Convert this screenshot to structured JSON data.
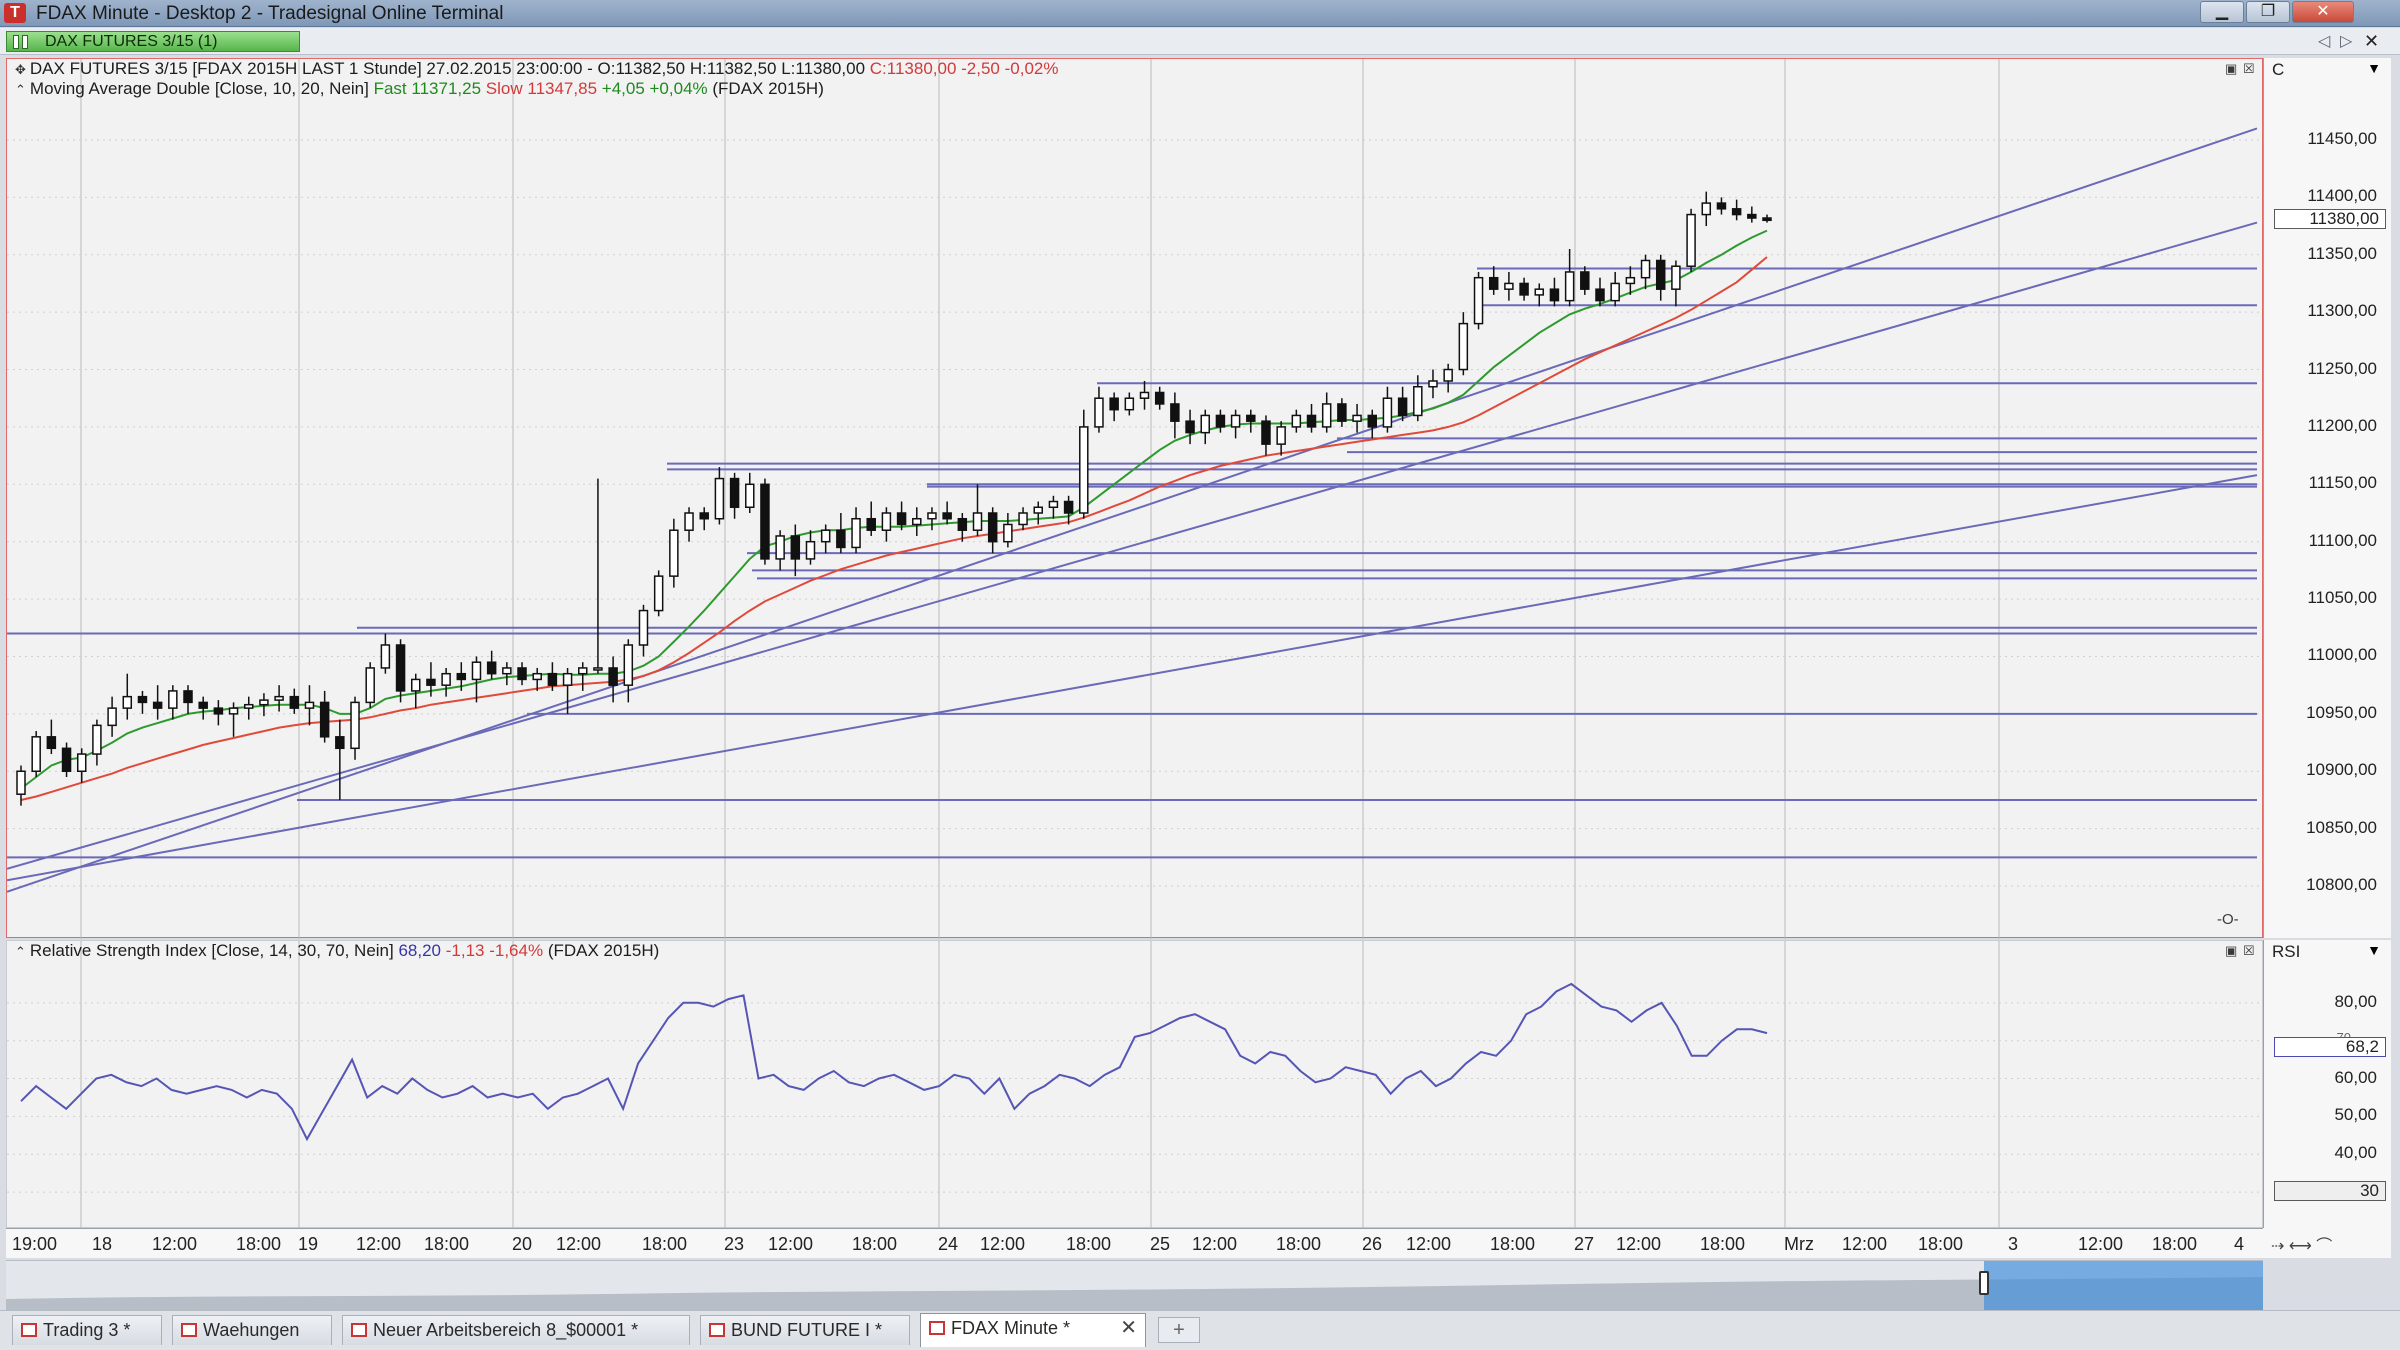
{
  "window": {
    "title": "FDAX Minute - Desktop 2 - Tradesignal Online Terminal",
    "app_icon": "tradesignal-icon",
    "controls": [
      "minimize-icon",
      "maximize-icon",
      "close-icon"
    ]
  },
  "chart_tab": {
    "label": "DAX FUTURES 3/15 (1)",
    "color": "#57b54b"
  },
  "price_pane": {
    "legend_line1": {
      "prefix": "DAX FUTURES 3/15 [FDAX 2015H LAST 1 Stunde] 27.02.2015 23:00:00 - O:11382,50 H:11382,50 L:11380,00",
      "close_change": "C:11380,00 -2,50 -0,02%"
    },
    "legend_line2": {
      "prefix": "Moving Average Double [Close, 10, 20, Nein]",
      "fast_label": "Fast",
      "fast_value": "11371,25",
      "slow_label": "Slow",
      "slow_value": "11347,85",
      "change": "+4,05 +0,04%",
      "symbol": "(FDAX 2015H)"
    },
    "axis_header": "C",
    "current_price_label": "11380,00",
    "axis_ticks": [
      "11450,00",
      "11400,00",
      "11350,00",
      "11300,00",
      "11250,00",
      "11200,00",
      "11150,00",
      "11100,00",
      "11050,00",
      "11000,00",
      "10950,00",
      "10900,00",
      "10850,00",
      "10800,00"
    ],
    "corner_icon": "-O-"
  },
  "rsi_pane": {
    "legend": {
      "prefix": "Relative Strength Index [Close, 14, 30, 70, Nein]",
      "value": "68,20",
      "change": "-1,13 -1,64%",
      "symbol": "(FDAX 2015H)"
    },
    "axis_header": "RSI",
    "axis_ticks": [
      "80,00",
      "70",
      "60,00",
      "50,00",
      "40,00"
    ],
    "current_value_label": "68,2",
    "lower_band_label": "30"
  },
  "time_axis": {
    "labels": [
      "19:00",
      "18",
      "12:00",
      "18:00",
      "19",
      "12:00",
      "18:00",
      "20",
      "12:00",
      "18:00",
      "23",
      "12:00",
      "18:00",
      "24",
      "12:00",
      "18:00",
      "25",
      "12:00",
      "18:00",
      "26",
      "12:00",
      "18:00",
      "27",
      "12:00",
      "18:00",
      "Mrz",
      "12:00",
      "18:00",
      "3",
      "12:00",
      "18:00",
      "4"
    ]
  },
  "bottom_tabs": [
    {
      "label": "Trading 3 *",
      "active": false
    },
    {
      "label": "Waehungen",
      "active": false
    },
    {
      "label": "Neuer Arbeitsbereich 8_$00001 *",
      "active": false
    },
    {
      "label": "BUND FUTURE I *",
      "active": false
    },
    {
      "label": "FDAX Minute *",
      "active": true
    }
  ],
  "colors": {
    "candle": "#111111",
    "fast_ma": "#2e9a2e",
    "slow_ma": "#e04a3a",
    "trendline": "#6a6ab8",
    "rsi_line": "#5555b5",
    "pane_border": "#e06a6a"
  },
  "chart_data": [
    {
      "type": "candlestick",
      "title": "DAX FUTURES 3/15",
      "ylim": [
        10780,
        11470
      ],
      "x_labels": [
        "18",
        "19",
        "20",
        "23",
        "24",
        "25",
        "26",
        "27"
      ],
      "candles": [
        [
          10880,
          10905,
          10870,
          10900
        ],
        [
          10900,
          10935,
          10895,
          10930
        ],
        [
          10930,
          10945,
          10915,
          10920
        ],
        [
          10920,
          10925,
          10895,
          10900
        ],
        [
          10900,
          10920,
          10890,
          10915
        ],
        [
          10915,
          10945,
          10905,
          10940
        ],
        [
          10940,
          10965,
          10930,
          10955
        ],
        [
          10955,
          10985,
          10945,
          10965
        ],
        [
          10965,
          10970,
          10950,
          10960
        ],
        [
          10960,
          10975,
          10945,
          10955
        ],
        [
          10955,
          10975,
          10945,
          10970
        ],
        [
          10970,
          10975,
          10950,
          10960
        ],
        [
          10960,
          10965,
          10945,
          10955
        ],
        [
          10955,
          10962,
          10940,
          10950
        ],
        [
          10950,
          10960,
          10930,
          10955
        ],
        [
          10955,
          10965,
          10945,
          10958
        ],
        [
          10958,
          10968,
          10948,
          10962
        ],
        [
          10962,
          10975,
          10952,
          10965
        ],
        [
          10965,
          10972,
          10950,
          10955
        ],
        [
          10955,
          10975,
          10940,
          10960
        ],
        [
          10960,
          10970,
          10925,
          10930
        ],
        [
          10930,
          10945,
          10875,
          10920
        ],
        [
          10920,
          10965,
          10910,
          10960
        ],
        [
          10960,
          10995,
          10955,
          10990
        ],
        [
          10990,
          11020,
          10985,
          11010
        ],
        [
          11010,
          11015,
          10960,
          10970
        ],
        [
          10970,
          10985,
          10955,
          10980
        ],
        [
          10980,
          10995,
          10965,
          10975
        ],
        [
          10975,
          10990,
          10965,
          10985
        ],
        [
          10985,
          10995,
          10970,
          10980
        ],
        [
          10980,
          11000,
          10960,
          10995
        ],
        [
          10995,
          11005,
          10980,
          10985
        ],
        [
          10985,
          10995,
          10975,
          10990
        ],
        [
          10990,
          10995,
          10975,
          10980
        ],
        [
          10980,
          10990,
          10970,
          10985
        ],
        [
          10985,
          10995,
          10970,
          10975
        ],
        [
          10975,
          10990,
          10950,
          10985
        ],
        [
          10985,
          10995,
          10970,
          10990
        ],
        [
          10990,
          11155,
          10985,
          10990
        ],
        [
          10990,
          11000,
          10960,
          10975
        ],
        [
          10975,
          11015,
          10960,
          11010
        ],
        [
          11010,
          11045,
          11000,
          11040
        ],
        [
          11040,
          11075,
          11035,
          11070
        ],
        [
          11070,
          11120,
          11060,
          11110
        ],
        [
          11110,
          11130,
          11100,
          11125
        ],
        [
          11125,
          11130,
          11110,
          11120
        ],
        [
          11120,
          11165,
          11115,
          11155
        ],
        [
          11155,
          11160,
          11120,
          11130
        ],
        [
          11130,
          11160,
          11125,
          11150
        ],
        [
          11150,
          11155,
          11080,
          11085
        ],
        [
          11085,
          11110,
          11075,
          11105
        ],
        [
          11105,
          11115,
          11070,
          11085
        ],
        [
          11085,
          11110,
          11080,
          11100
        ],
        [
          11100,
          11115,
          11090,
          11110
        ],
        [
          11110,
          11125,
          11090,
          11095
        ],
        [
          11095,
          11130,
          11090,
          11120
        ],
        [
          11120,
          11135,
          11105,
          11110
        ],
        [
          11110,
          11130,
          11100,
          11125
        ],
        [
          11125,
          11135,
          11110,
          11115
        ],
        [
          11115,
          11130,
          11105,
          11120
        ],
        [
          11120,
          11130,
          11110,
          11125
        ],
        [
          11125,
          11135,
          11115,
          11120
        ],
        [
          11120,
          11125,
          11100,
          11110
        ],
        [
          11110,
          11150,
          11105,
          11125
        ],
        [
          11125,
          11130,
          11090,
          11100
        ],
        [
          11100,
          11125,
          11095,
          11115
        ],
        [
          11115,
          11130,
          11110,
          11125
        ],
        [
          11125,
          11135,
          11115,
          11130
        ],
        [
          11130,
          11140,
          11120,
          11135
        ],
        [
          11135,
          11140,
          11115,
          11125
        ],
        [
          11125,
          11215,
          11120,
          11200
        ],
        [
          11200,
          11235,
          11195,
          11225
        ],
        [
          11225,
          11230,
          11205,
          11215
        ],
        [
          11215,
          11230,
          11210,
          11225
        ],
        [
          11225,
          11240,
          11215,
          11230
        ],
        [
          11230,
          11235,
          11215,
          11220
        ],
        [
          11220,
          11230,
          11190,
          11205
        ],
        [
          11205,
          11215,
          11185,
          11195
        ],
        [
          11195,
          11215,
          11185,
          11210
        ],
        [
          11210,
          11215,
          11195,
          11200
        ],
        [
          11200,
          11215,
          11190,
          11210
        ],
        [
          11210,
          11215,
          11195,
          11205
        ],
        [
          11205,
          11210,
          11175,
          11185
        ],
        [
          11185,
          11205,
          11175,
          11200
        ],
        [
          11200,
          11215,
          11195,
          11210
        ],
        [
          11210,
          11220,
          11195,
          11200
        ],
        [
          11200,
          11230,
          11195,
          11220
        ],
        [
          11220,
          11225,
          11200,
          11205
        ],
        [
          11205,
          11220,
          11195,
          11210
        ],
        [
          11210,
          11215,
          11190,
          11200
        ],
        [
          11200,
          11235,
          11195,
          11225
        ],
        [
          11225,
          11235,
          11205,
          11210
        ],
        [
          11210,
          11245,
          11205,
          11235
        ],
        [
          11235,
          11250,
          11225,
          11240
        ],
        [
          11240,
          11255,
          11230,
          11250
        ],
        [
          11250,
          11300,
          11245,
          11290
        ],
        [
          11290,
          11335,
          11285,
          11330
        ],
        [
          11330,
          11340,
          11315,
          11320
        ],
        [
          11320,
          11335,
          11310,
          11325
        ],
        [
          11325,
          11330,
          11310,
          11315
        ],
        [
          11315,
          11325,
          11305,
          11320
        ],
        [
          11320,
          11330,
          11305,
          11310
        ],
        [
          11310,
          11355,
          11305,
          11335
        ],
        [
          11335,
          11340,
          11315,
          11320
        ],
        [
          11320,
          11330,
          11305,
          11310
        ],
        [
          11310,
          11335,
          11305,
          11325
        ],
        [
          11325,
          11340,
          11315,
          11330
        ],
        [
          11330,
          11350,
          11320,
          11345
        ],
        [
          11345,
          11350,
          11310,
          11320
        ],
        [
          11320,
          11345,
          11305,
          11340
        ],
        [
          11340,
          11390,
          11335,
          11385
        ],
        [
          11385,
          11405,
          11375,
          11395
        ],
        [
          11395,
          11400,
          11385,
          11390
        ],
        [
          11390,
          11398,
          11380,
          11385
        ],
        [
          11385,
          11392,
          11378,
          11382
        ],
        [
          11382,
          11385,
          11378,
          11380
        ]
      ],
      "moving_average_fast": [
        10885,
        10895,
        10905,
        10910,
        10912,
        10918,
        10925,
        10933,
        10938,
        10942,
        10946,
        10950,
        10952,
        10953,
        10955,
        10956,
        10957,
        10958,
        10958,
        10958,
        10955,
        10950,
        10950,
        10955,
        10963,
        10966,
        10968,
        10970,
        10972,
        10974,
        10977,
        10980,
        10982,
        10983,
        10984,
        10985,
        10984,
        10984,
        10985,
        10985,
        10987,
        10992,
        11000,
        11013,
        11026,
        11040,
        11055,
        11070,
        11085,
        11096,
        11100,
        11105,
        11108,
        11110,
        11110,
        11112,
        11113,
        11113,
        11113,
        11114,
        11115,
        11116,
        11117,
        11118,
        11118,
        11118,
        11119,
        11120,
        11121,
        11122,
        11130,
        11140,
        11150,
        11160,
        11170,
        11180,
        11188,
        11193,
        11197,
        11200,
        11202,
        11203,
        11203,
        11203,
        11203,
        11204,
        11205,
        11206,
        11206,
        11207,
        11208,
        11210,
        11213,
        11216,
        11221,
        11228,
        11240,
        11252,
        11262,
        11272,
        11282,
        11290,
        11298,
        11303,
        11307,
        11312,
        11317,
        11322,
        11325,
        11328,
        11335,
        11343,
        11350,
        11358,
        11365,
        11371
      ],
      "moving_average_slow": [
        10875,
        10878,
        10882,
        10886,
        10890,
        10894,
        10898,
        10903,
        10907,
        10911,
        10915,
        10919,
        10923,
        10926,
        10929,
        10932,
        10935,
        10938,
        10940,
        10942,
        10943,
        10944,
        10945,
        10947,
        10950,
        10953,
        10955,
        10958,
        10960,
        10962,
        10964,
        10966,
        10968,
        10970,
        10972,
        10974,
        10975,
        10976,
        10977,
        10978,
        10980,
        10983,
        10988,
        10995,
        11003,
        11012,
        11021,
        11031,
        11040,
        11048,
        11054,
        11060,
        11066,
        11071,
        11076,
        11080,
        11084,
        11088,
        11091,
        11094,
        11097,
        11100,
        11103,
        11105,
        11107,
        11109,
        11111,
        11113,
        11115,
        11117,
        11121,
        11126,
        11131,
        11136,
        11142,
        11148,
        11153,
        11158,
        11162,
        11166,
        11169,
        11172,
        11175,
        11177,
        11179,
        11181,
        11183,
        11185,
        11187,
        11189,
        11191,
        11193,
        11195,
        11197,
        11200,
        11204,
        11210,
        11217,
        11224,
        11231,
        11238,
        11245,
        11252,
        11259,
        11265,
        11271,
        11277,
        11283,
        11289,
        11295,
        11302,
        11310,
        11318,
        11326,
        11337,
        11348
      ],
      "horizontal_lines": [
        11338,
        11306,
        11238,
        11190,
        11178,
        11168,
        11163,
        11150,
        11148,
        11090,
        11075,
        11068,
        11025,
        11020,
        10950,
        10875,
        10825
      ],
      "trendlines": [
        {
          "from": [
            0,
            10795
          ],
          "to": [
            1,
            11460
          ]
        },
        {
          "from": [
            0,
            10815
          ],
          "to": [
            1,
            11378
          ]
        },
        {
          "from": [
            0,
            10805
          ],
          "to": [
            1,
            11158
          ]
        }
      ]
    },
    {
      "type": "line",
      "title": "Relative Strength Index",
      "ylim": [
        25,
        90
      ],
      "series": [
        {
          "name": "RSI",
          "values": [
            54,
            58,
            55,
            52,
            56,
            60,
            61,
            59,
            58,
            60,
            57,
            56,
            57,
            58,
            57,
            55,
            57,
            56,
            52,
            44,
            51,
            58,
            65,
            55,
            58,
            56,
            60,
            57,
            55,
            56,
            58,
            55,
            56,
            55,
            56,
            52,
            55,
            56,
            58,
            60,
            52,
            64,
            70,
            76,
            80,
            80,
            79,
            81,
            82,
            60,
            61,
            58,
            57,
            60,
            62,
            59,
            58,
            60,
            61,
            59,
            57,
            58,
            61,
            60,
            56,
            60,
            52,
            56,
            58,
            61,
            60,
            58,
            61,
            63,
            71,
            72,
            74,
            76,
            77,
            75,
            73,
            66,
            64,
            67,
            66,
            62,
            59,
            60,
            63,
            62,
            61,
            56,
            60,
            62,
            58,
            60,
            64,
            67,
            66,
            70,
            77,
            79,
            83,
            85,
            82,
            79,
            78,
            75,
            78,
            80,
            74,
            66,
            66,
            70,
            73,
            73,
            72
          ]
        }
      ]
    }
  ]
}
